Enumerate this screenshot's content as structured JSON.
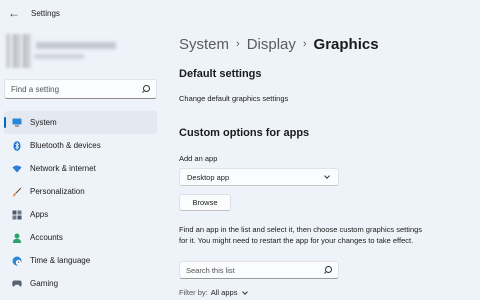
{
  "window": {
    "title": "Settings"
  },
  "sidebar": {
    "search_placeholder": "Find a setting",
    "items": [
      {
        "label": "System",
        "icon": "monitor-icon",
        "active": true
      },
      {
        "label": "Bluetooth & devices",
        "icon": "bluetooth-icon"
      },
      {
        "label": "Network & internet",
        "icon": "wifi-icon"
      },
      {
        "label": "Personalization",
        "icon": "brush-icon"
      },
      {
        "label": "Apps",
        "icon": "apps-grid-icon"
      },
      {
        "label": "Accounts",
        "icon": "person-icon"
      },
      {
        "label": "Time & language",
        "icon": "globe-clock-icon"
      },
      {
        "label": "Gaming",
        "icon": "gamepad-icon"
      }
    ]
  },
  "breadcrumb": {
    "part1": "System",
    "part2": "Display",
    "current": "Graphics",
    "separator": "›"
  },
  "default_settings": {
    "heading": "Default settings",
    "link": "Change default graphics settings"
  },
  "custom_options": {
    "heading": "Custom options for apps",
    "add_label": "Add an app",
    "app_type_selected": "Desktop app",
    "browse_label": "Browse",
    "description": "Find an app in the list and select it, then choose custom graphics settings for it. You might need to restart the app for your changes to take effect.",
    "search_placeholder": "Search this list",
    "filter_label": "Filter by:",
    "filter_value": "All apps"
  },
  "colors": {
    "accent": "#0067c0",
    "background": "#eef2f9"
  }
}
